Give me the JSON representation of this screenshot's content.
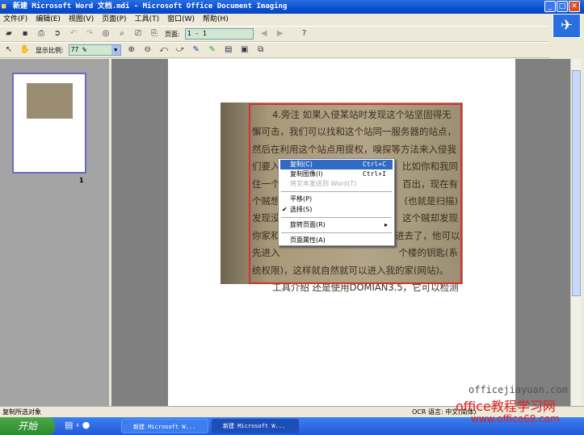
{
  "window": {
    "title": "新建 Microsoft Word 文档.mdi - Microsoft Office Document Imaging"
  },
  "menu": [
    "文件(F)",
    "编辑(E)",
    "视图(V)",
    "页面(P)",
    "工具(T)",
    "窗口(W)",
    "帮助(H)"
  ],
  "toolbar": {
    "page_label": "页面:",
    "page_value": "1 - 1",
    "zoom_label": "显示比例:",
    "zoom_value": "77 %"
  },
  "thumbnail": {
    "page_number": "1"
  },
  "document_lines": [
    {
      "left": "4.旁注  如果入侵某站时发现这个站坚固得无",
      "right": ""
    },
    {
      "left": "懈可击，我们可以找和这个站同一服务器的站点，",
      "right": ""
    },
    {
      "left": "然后在利用这个站点用提权，嗅探等方法来入侵我",
      "right": ""
    },
    {
      "left": "们要入",
      "right": "比如你和我同"
    },
    {
      "left": "住一个",
      "right": "百出，现在有"
    },
    {
      "left": "个贼想",
      "right": "(也就是扫描)"
    },
    {
      "left": "发现没",
      "right": "这个贼却发现"
    },
    {
      "left": "你家和",
      "right": "进去了，他可以"
    },
    {
      "left": "先进入",
      "right": "个楼的钥匙(系"
    },
    {
      "left": "统权限)，这样就自然就可以进入我的家(网站)。",
      "right": ""
    },
    {
      "left": "工具介绍  还是使用DOMIAN3.5，它可以检测",
      "right": ""
    }
  ],
  "context_menu": {
    "items": [
      {
        "label": "复制(C)",
        "shortcut": "Ctrl+C",
        "highlighted": true
      },
      {
        "label": "复制图像(I)",
        "shortcut": "Ctrl+I"
      },
      {
        "label": "将文本发送到 Word(T)",
        "disabled": true
      },
      {
        "label": "平移(P)"
      },
      {
        "label": "选择(S)",
        "checked": true
      },
      {
        "label": "旋转页面(R)",
        "submenu": true
      },
      {
        "label": "页面属性(A)"
      }
    ]
  },
  "status": {
    "text": "复制所选对象",
    "ocr": "OCR 语言: 中文(简体)"
  },
  "taskbar": {
    "start": "开始",
    "tasks": [
      "新建 Microsoft W...",
      "新建 Microsoft W..."
    ]
  },
  "watermark": {
    "line1": "officejiayuan.com",
    "line2": "office教程学习网",
    "line3": "www.office68.com"
  },
  "colors": {
    "titlebar": "#0a4fd0",
    "selection_border": "#d83030",
    "menu_highlight": "#316ac5"
  }
}
